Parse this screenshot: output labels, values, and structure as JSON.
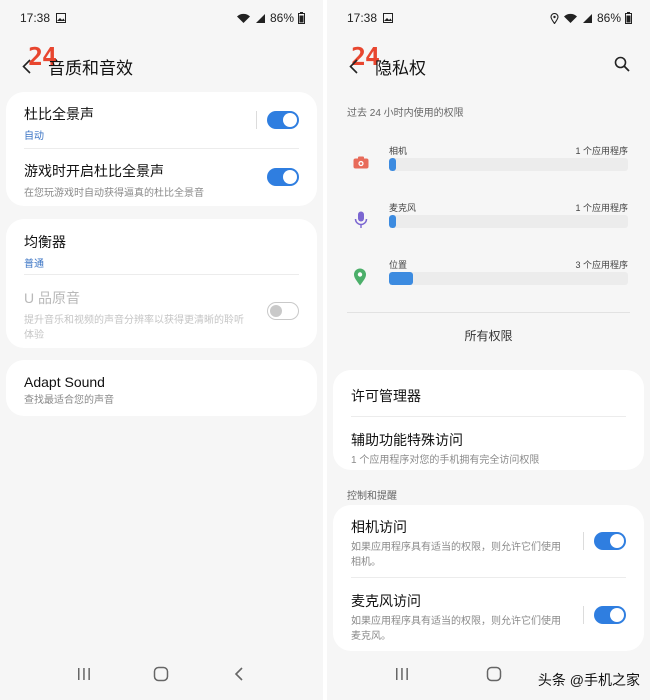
{
  "left": {
    "status": {
      "time": "17:38",
      "battery": "86%"
    },
    "logo": "24",
    "title": "音质和音效",
    "dolby": {
      "label": "杜比全景声",
      "sub": "自动",
      "enabled": true
    },
    "game_dolby": {
      "label": "游戏时开启杜比全景声",
      "sub": "在您玩游戏时自动获得逼真的杜比全景音",
      "enabled": true
    },
    "equalizer": {
      "label": "均衡器",
      "sub": "普通"
    },
    "uhq": {
      "label": "U 品原音",
      "sub": "提升音乐和视频的声音分辨率以获得更清晰的聆听体验",
      "enabled": false
    },
    "adapt": {
      "label": "Adapt Sound",
      "sub": "查找最适合您的声音"
    }
  },
  "right": {
    "status": {
      "time": "17:38",
      "battery": "86%"
    },
    "logo": "24",
    "title": "隐私权",
    "recent_header": "过去 24 小时内使用的权限",
    "permissions": [
      {
        "name": "相机",
        "count": "1 个应用程序",
        "icon": "camera-icon",
        "color": "#e86b5a",
        "level": 0.02
      },
      {
        "name": "麦克风",
        "count": "1 个应用程序",
        "icon": "microphone-icon",
        "color": "#7b66d1",
        "level": 0.02
      },
      {
        "name": "位置",
        "count": "3 个应用程序",
        "icon": "location-pin-icon",
        "color": "#4caf6a",
        "level": 0.1
      }
    ],
    "all_permissions": "所有权限",
    "permission_manager": "许可管理器",
    "accessibility": {
      "label": "辅助功能特殊访问",
      "sub": "1 个应用程序对您的手机拥有完全访问权限"
    },
    "controls_header": "控制和提醒",
    "camera_access": {
      "label": "相机访问",
      "sub": "如果应用程序具有适当的权限，则允许它们使用相机。",
      "enabled": true
    },
    "mic_access": {
      "label": "麦克风访问",
      "sub": "如果应用程序具有适当的权限，则允许它们使用麦克风。",
      "enabled": true
    }
  },
  "watermark": "头条 @手机之家"
}
